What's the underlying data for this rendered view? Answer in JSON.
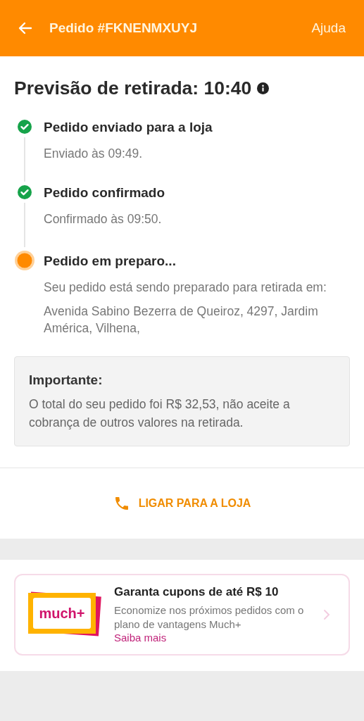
{
  "header": {
    "title": "Pedido #FKNENMXUYJ",
    "help": "Ajuda"
  },
  "pickup": {
    "title": "Previsão de retirada: 10:40"
  },
  "steps": [
    {
      "title": "Pedido enviado para a loja",
      "completed": true,
      "lines": [
        "Enviado às 09:49."
      ]
    },
    {
      "title": "Pedido confirmado",
      "completed": true,
      "lines": [
        "Confirmado às 09:50."
      ]
    },
    {
      "title": "Pedido em preparo...",
      "completed": false,
      "lines": [
        "Seu pedido está sendo preparado para retirada em:",
        "Avenida Sabino Bezerra de Queiroz, 4297, Jardim América, Vilhena,"
      ]
    }
  ],
  "notice": {
    "title": "Importante:",
    "text": "O total do seu pedido foi R$ 32,53, não aceite a cobrança de outros valores na retirada."
  },
  "call_button": "LIGAR PARA A LOJA",
  "promo": {
    "logo": "much+",
    "title": "Garanta cupons de até R$ 10",
    "text": "Economize nos próximos pedidos com o plano de vantagens Much+",
    "link": "Saiba mais"
  }
}
